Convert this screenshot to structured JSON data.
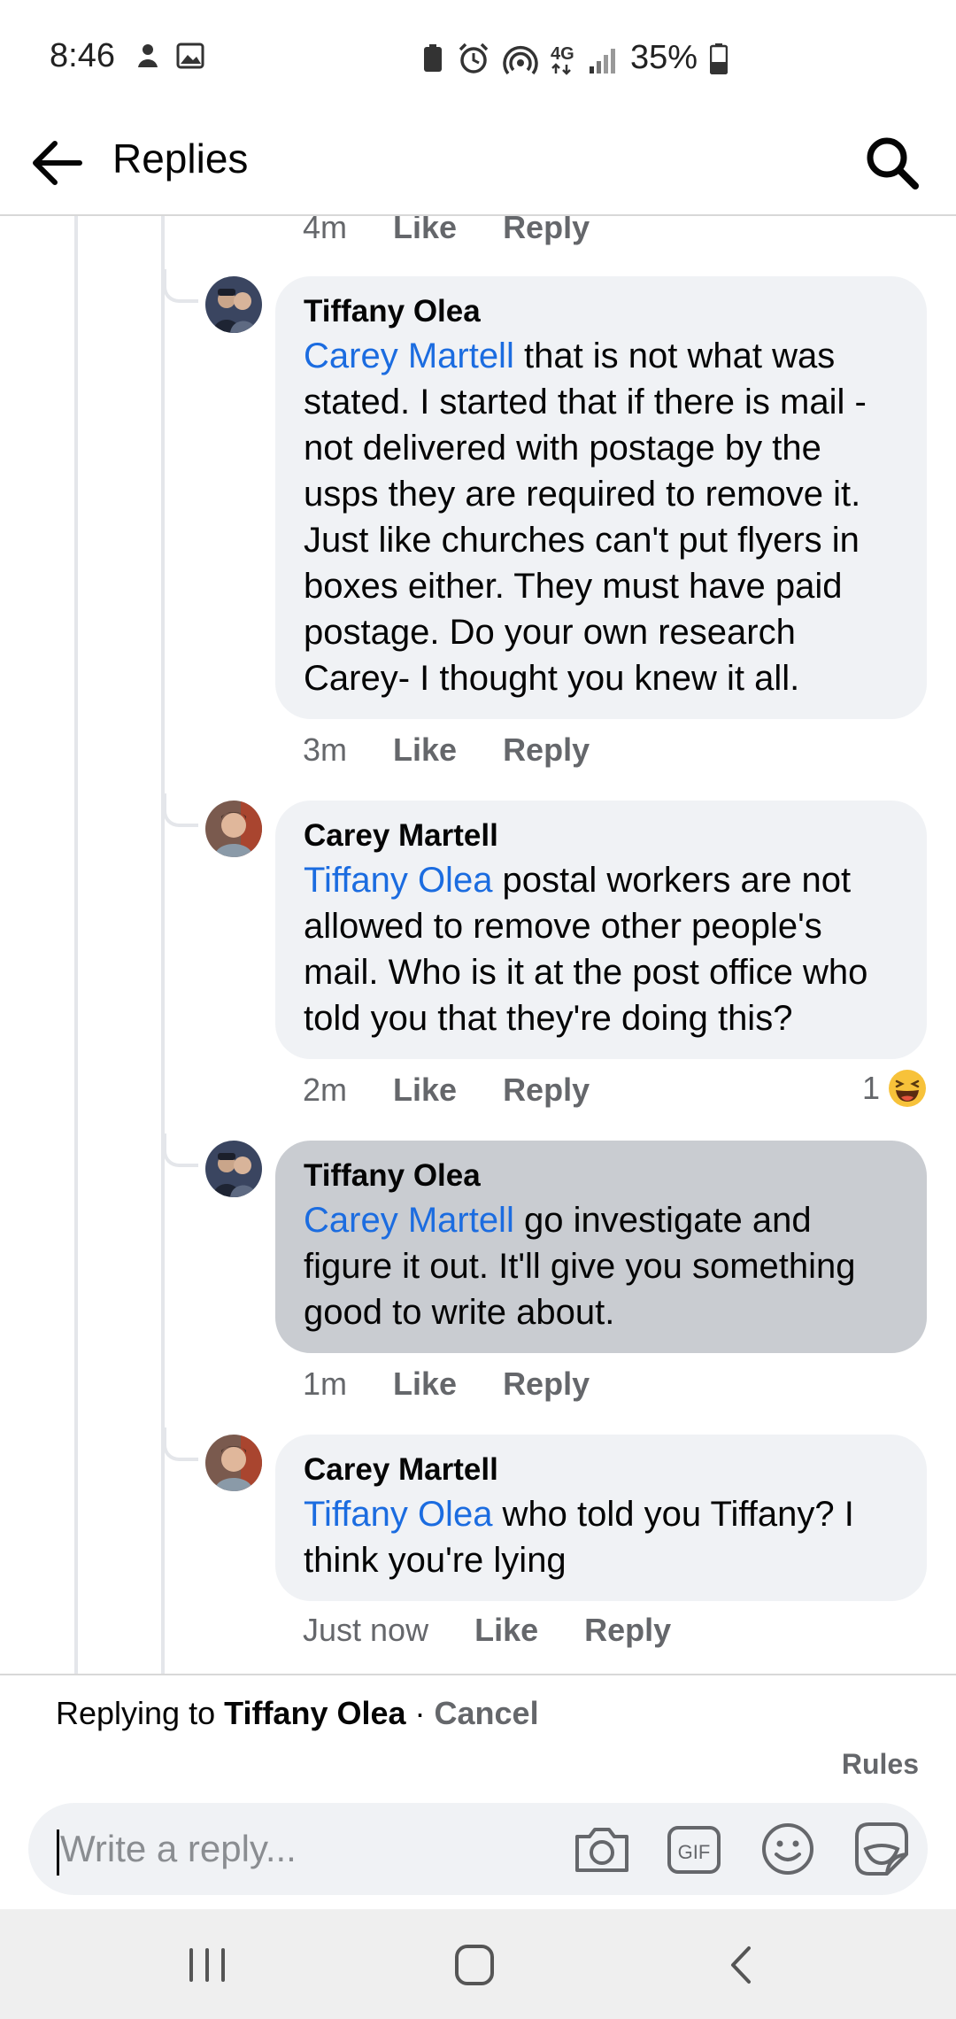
{
  "status_bar": {
    "time": "8:46",
    "battery": "35%"
  },
  "header": {
    "title": "Replies"
  },
  "top_actions": {
    "time": "4m",
    "like": "Like",
    "reply": "Reply"
  },
  "comments": [
    {
      "author": "Tiffany Olea",
      "mention": "Carey Martell",
      "text": " that is not what was stated.  I started that if there is mail - not delivered with postage by the usps they are required to remove it.  Just like churches can't put flyers in boxes either.  They must have paid postage.  Do your own research Carey- I thought you knew it all.",
      "time": "3m",
      "like": "Like",
      "reply": "Reply"
    },
    {
      "author": "Carey Martell",
      "mention": "Tiffany Olea",
      "text": " postal workers are not allowed to remove other people's mail. Who is it at the post office who told you that they're doing this?",
      "time": "2m",
      "like": "Like",
      "reply": "Reply",
      "reaction_count": "1"
    },
    {
      "author": "Tiffany Olea",
      "mention": "Carey Martell",
      "text": " go investigate and figure it out.  It'll give you something good to write about.",
      "time": "1m",
      "like": "Like",
      "reply": "Reply"
    },
    {
      "author": "Carey Martell",
      "mention": "Tiffany Olea",
      "text": " who told you Tiffany? I think you're lying",
      "time": "Just now",
      "like": "Like",
      "reply": "Reply"
    }
  ],
  "composer": {
    "replying_prefix": "Replying to ",
    "replying_name": "Tiffany Olea",
    "separator": " · ",
    "cancel": "Cancel",
    "rules": "Rules",
    "placeholder": "Write a reply..."
  },
  "colors": {
    "mention": "#1b6ce0",
    "bubble": "#f0f2f5",
    "bubble_selected": "#c9ccd1",
    "meta": "#65676b"
  },
  "icons": [
    "back-arrow-icon",
    "search-icon",
    "camera-icon",
    "gif-icon",
    "emoji-icon",
    "sticker-icon",
    "recents-icon",
    "home-icon",
    "nav-back-icon",
    "laughing-reaction-icon"
  ]
}
